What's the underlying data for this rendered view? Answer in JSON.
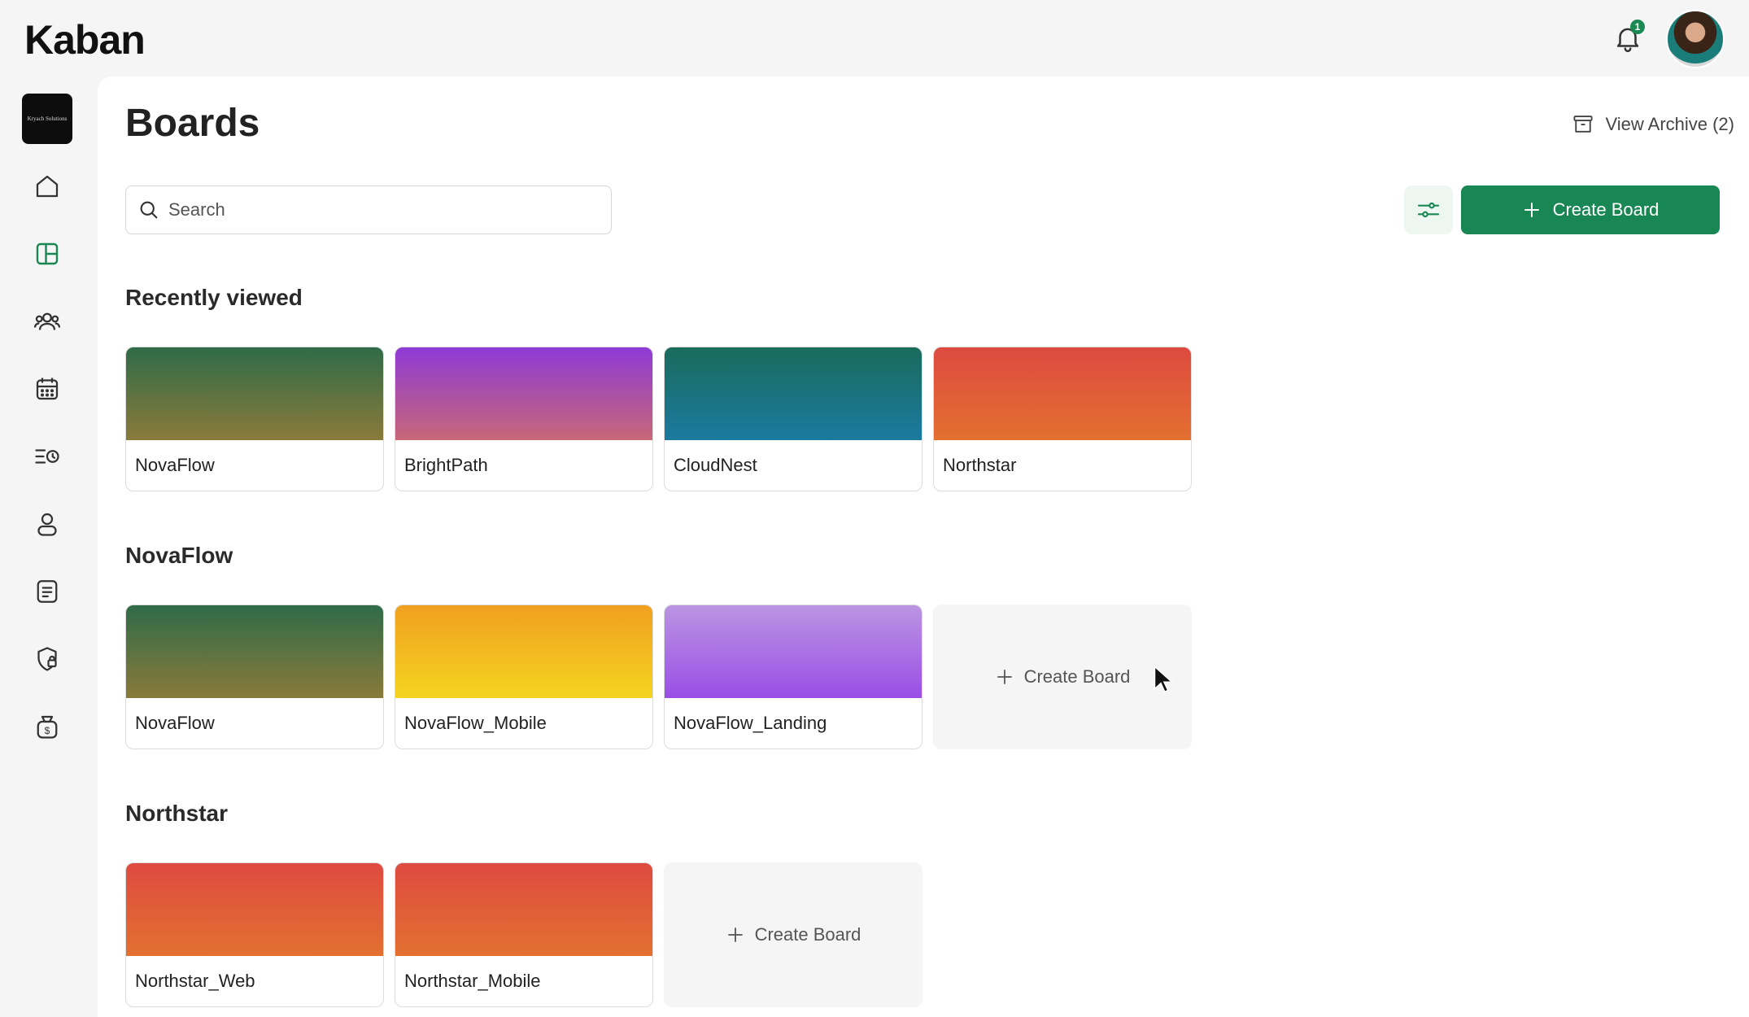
{
  "app": {
    "logo": "Kaban",
    "notification_count": "1"
  },
  "sidebar": {
    "workspace_logo_text": "Kryach Solutions",
    "items": [
      {
        "name": "home",
        "icon": "home-icon"
      },
      {
        "name": "boards",
        "icon": "boards-icon",
        "active": true
      },
      {
        "name": "teams",
        "icon": "users-icon"
      },
      {
        "name": "calendar",
        "icon": "calendar-icon"
      },
      {
        "name": "timeline",
        "icon": "list-clock-icon"
      },
      {
        "name": "profile",
        "icon": "user-icon"
      },
      {
        "name": "documents",
        "icon": "document-icon"
      },
      {
        "name": "security",
        "icon": "shield-lock-icon"
      },
      {
        "name": "billing",
        "icon": "money-bag-icon"
      }
    ],
    "active_color": "#188753"
  },
  "header": {
    "title": "Boards",
    "archive_label": "View Archive (2)"
  },
  "search": {
    "placeholder": "Search"
  },
  "toolbar": {
    "create_label": "Create Board"
  },
  "sections": [
    {
      "title": "Recently viewed",
      "boards": [
        {
          "name": "NovaFlow",
          "cover": "green"
        },
        {
          "name": "BrightPath",
          "cover": "purple"
        },
        {
          "name": "CloudNest",
          "cover": "teal"
        },
        {
          "name": "Northstar",
          "cover": "red"
        }
      ]
    },
    {
      "title": "NovaFlow",
      "boards": [
        {
          "name": "NovaFlow",
          "cover": "green"
        },
        {
          "name": "NovaFlow_Mobile",
          "cover": "yellow"
        },
        {
          "name": "NovaFlow_Landing",
          "cover": "lavender"
        }
      ],
      "add_label": "Create Board"
    },
    {
      "title": "Northstar",
      "boards": [
        {
          "name": "Northstar_Web",
          "cover": "red"
        },
        {
          "name": "Northstar_Mobile",
          "cover": "red"
        }
      ],
      "add_label": "Create Board"
    }
  ]
}
